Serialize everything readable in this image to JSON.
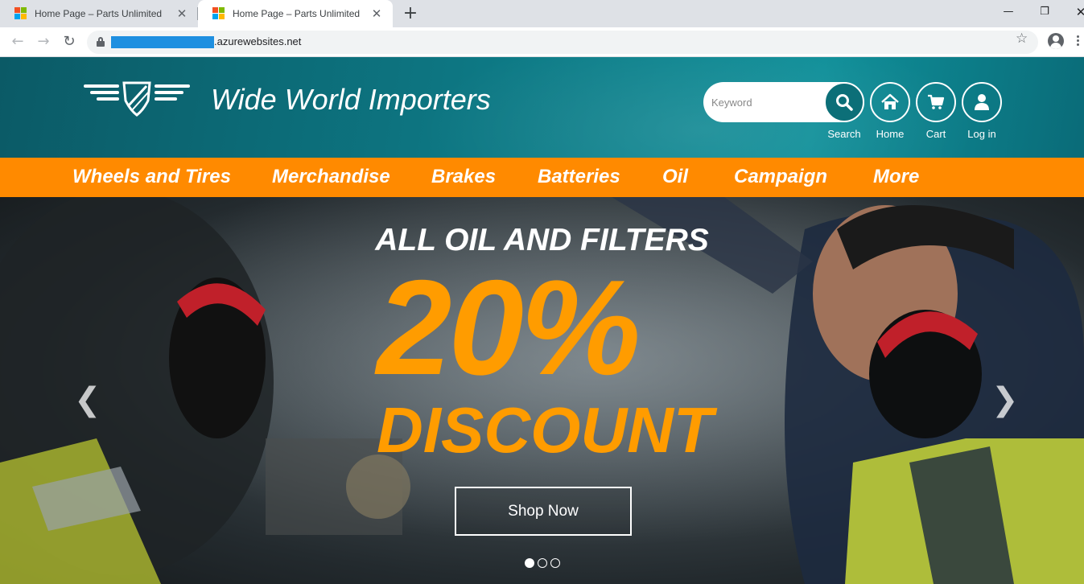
{
  "browser": {
    "tabs": [
      {
        "title": "Home Page – Parts Unlimited",
        "active": false
      },
      {
        "title": "Home Page – Parts Unlimited",
        "active": true
      }
    ],
    "close_glyph": "✕",
    "new_tab_glyph": "+",
    "url": ".azurewebsites.net",
    "window_controls": {
      "minimize": "—",
      "maximize": "❐",
      "close": "✕"
    },
    "nav": {
      "back": "←",
      "forward": "→",
      "reload": "↻"
    },
    "star_glyph": "☆"
  },
  "header": {
    "brand_name": "Wide World Importers",
    "search": {
      "placeholder": "Keyword",
      "label": "Search"
    },
    "home_label": "Home",
    "cart_label": "Cart",
    "login_label": "Log in",
    "icons": [
      "search-icon",
      "home-icon",
      "cart-icon",
      "user-icon"
    ]
  },
  "categories": [
    "Wheels and Tires",
    "Merchandise",
    "Brakes",
    "Batteries",
    "Oil",
    "Campaign",
    "More"
  ],
  "hero": {
    "headline": "ALL OIL AND FILTERS",
    "discount_value": "20%",
    "discount_word": "DISCOUNT",
    "cta_label": "Shop Now",
    "prev_glyph": "❮",
    "next_glyph": "❯",
    "slide_count": 3,
    "active_slide": 1
  },
  "colors": {
    "header_teal": "#0d7581",
    "nav_orange": "#ff8a00",
    "discount_orange": "#ff9c00",
    "url_redaction": "#1e8fe0"
  }
}
